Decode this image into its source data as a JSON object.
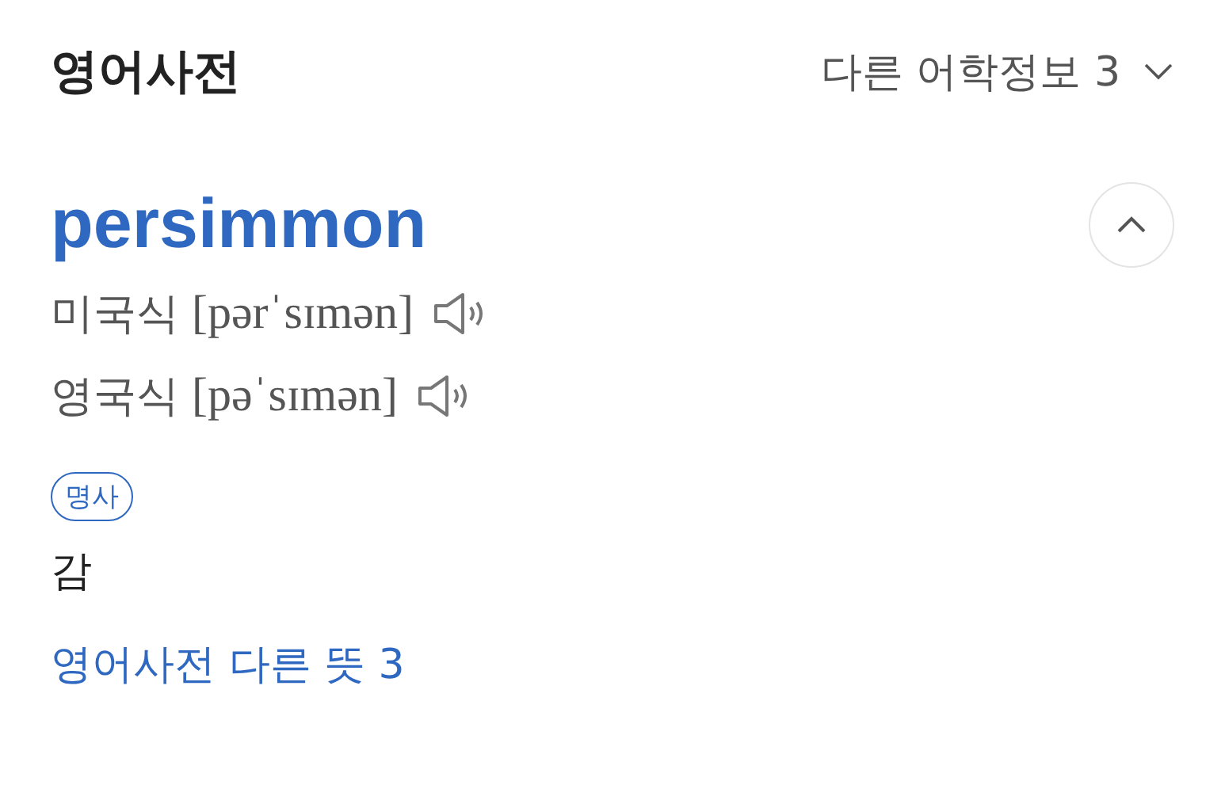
{
  "header": {
    "title": "영어사전",
    "more_info": {
      "label": "다른 어학정보 3",
      "expanded": false
    }
  },
  "entry": {
    "word": "persimmon",
    "collapse_button": {
      "expanded": true
    },
    "pronunciations": [
      {
        "label": "미국식",
        "ipa": "[pərˈsɪmən]"
      },
      {
        "label": "영국식",
        "ipa": "[pəˈsɪmən]"
      }
    ],
    "part_of_speech": "명사",
    "meaning": "감",
    "more_link": "영어사전 다른 뜻 3"
  }
}
